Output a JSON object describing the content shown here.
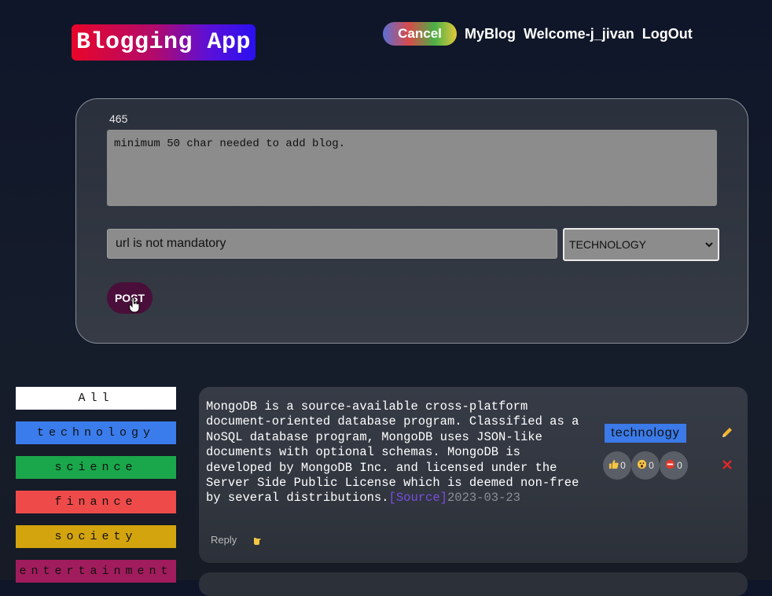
{
  "header": {
    "logo": "Blogging App",
    "nav": {
      "cancel_label": "Cancel",
      "myblog_label": "MyBlog",
      "welcome_label": "Welcome-j_jivan",
      "logout_label": "LogOut"
    }
  },
  "composer": {
    "char_count": "465",
    "textarea_placeholder": "minimum 50 char needed to add blog.",
    "url_placeholder": "url is not mandatory",
    "category_selected": "TECHNOLOGY",
    "post_label": "POST"
  },
  "filters": [
    {
      "label": "All",
      "color": "#ffffff"
    },
    {
      "label": "technology",
      "color": "#3b7cec"
    },
    {
      "label": "science",
      "color": "#1aa64a"
    },
    {
      "label": "finance",
      "color": "#ee4a4a"
    },
    {
      "label": "society",
      "color": "#d3a40e"
    },
    {
      "label": "entertainment",
      "color": "#a11c5c"
    }
  ],
  "blog": {
    "text": "MongoDB is a source-available cross-platform document-oriented database program. Classified as a NoSQL database program, MongoDB uses JSON-like documents with optional schemas. MongoDB is developed by MongoDB Inc. and licensed under the Server Side Public License which is deemed non-free by several distributions.",
    "source_label": "[Source]",
    "date": "2023-03-23",
    "tag": "technology",
    "reactions": [
      {
        "icon": "thumbs-up-icon",
        "count": "0"
      },
      {
        "icon": "astonished-face-icon",
        "count": "0"
      },
      {
        "icon": "no-entry-icon",
        "count": "0"
      }
    ],
    "reply_label": "Reply"
  }
}
